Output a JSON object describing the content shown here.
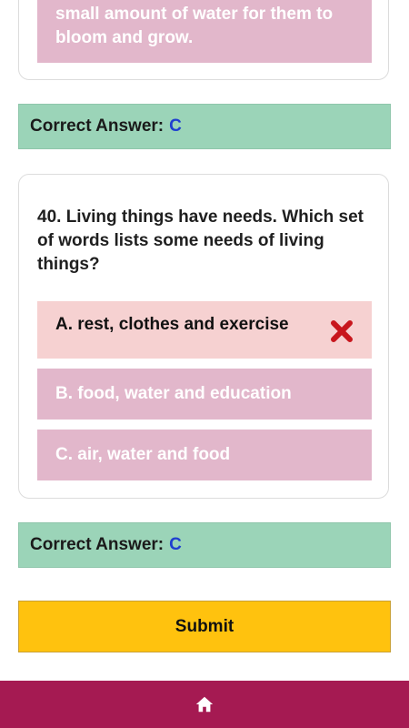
{
  "previous_question": {
    "option_text": "small amount of water for them to bloom and grow."
  },
  "previous_answer": {
    "label": "Correct Answer:",
    "letter": "C"
  },
  "question": {
    "text": "40. Living things have needs. Which set of words lists some needs of living things?",
    "options": [
      {
        "label": "A. rest, clothes and exercise",
        "state": "wrong"
      },
      {
        "label": "B. food, water and education",
        "state": "neutral"
      },
      {
        "label": "C. air, water and food",
        "state": "neutral"
      }
    ]
  },
  "answer": {
    "label": "Correct Answer:",
    "letter": "C"
  },
  "submit": {
    "label": "Submit"
  },
  "nav": {
    "home_icon": "home-icon"
  },
  "colors": {
    "option_neutral": "#e2b7cb",
    "option_wrong": "#f6d1d1",
    "answer_bg": "#9bd4b8",
    "answer_letter": "#1f3fd0",
    "submit_bg": "#ffc20e",
    "nav_bg": "#a51a52",
    "wrong_mark": "#c8161d"
  }
}
